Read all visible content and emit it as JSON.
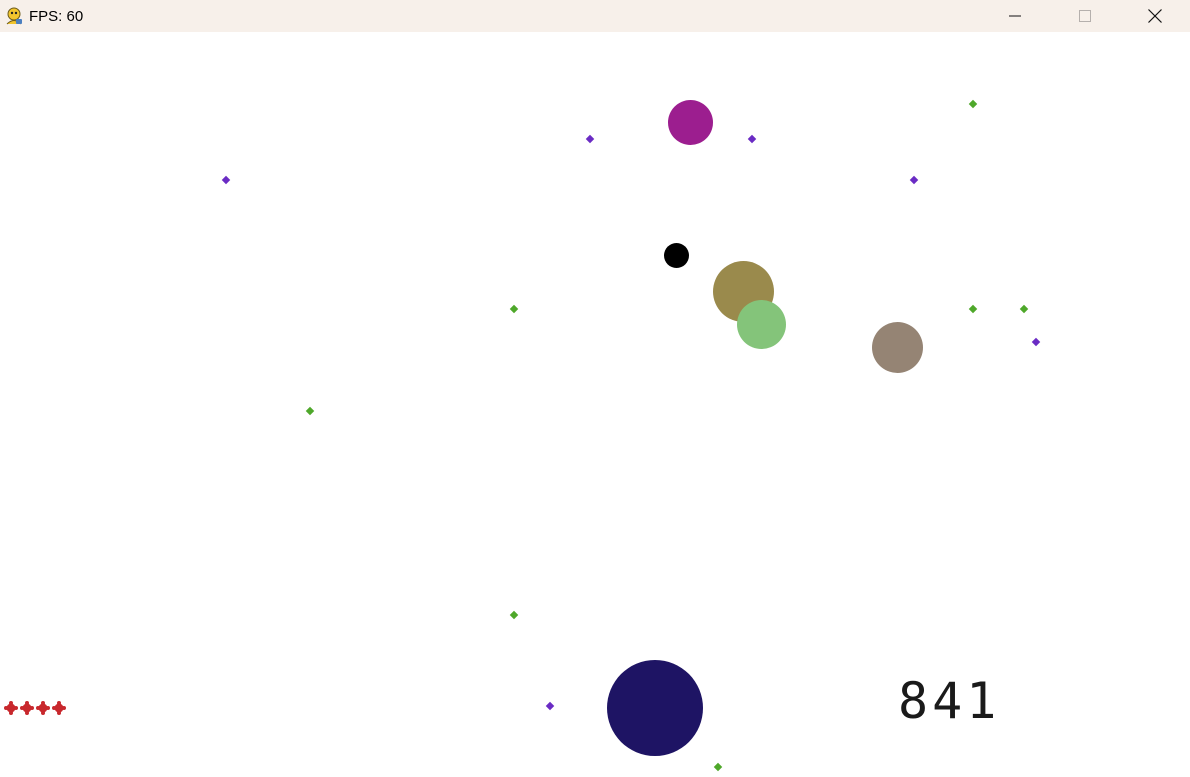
{
  "window": {
    "title": "FPS: 60",
    "app_icon": "pygame-snake-icon",
    "controls": [
      {
        "name": "minimize-button",
        "icon": "minimize-icon"
      },
      {
        "name": "maximize-button",
        "icon": "maximize-icon"
      },
      {
        "name": "close-button",
        "icon": "close-icon"
      }
    ]
  },
  "game": {
    "score": "841",
    "lives": 4,
    "colors": {
      "background": "#ffffff",
      "player": "#1e1464",
      "life": "#c8282d",
      "pellet_green": "#4ea82a",
      "pellet_purple": "#6a2bc4",
      "enemy_magenta": "#9c1e8f",
      "enemy_black": "#000000",
      "enemy_olive": "#9a8a4c",
      "enemy_green": "#84c47a",
      "enemy_taupe": "#958474"
    }
  }
}
